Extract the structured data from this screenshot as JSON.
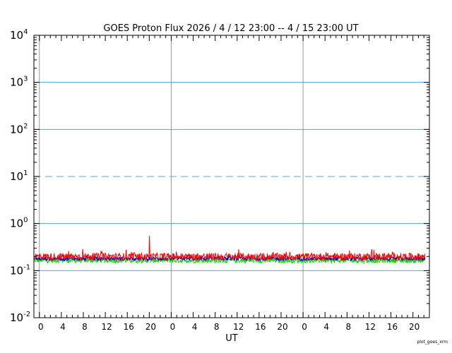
{
  "chart_data": {
    "type": "line",
    "title": "GOES Proton Flux   2026  /  4  / 12   23:00  --   4  / 15   23:00   UT",
    "xlabel": "UT",
    "credit": "plot_goes_xrm",
    "y_scale": "log",
    "ylim": [
      0.01,
      10000
    ],
    "y_ticks": [
      {
        "base": "10",
        "exp": "-2",
        "value": 0.01
      },
      {
        "base": "10",
        "exp": "-1",
        "value": 0.1
      },
      {
        "base": "10",
        "exp": "0",
        "value": 1
      },
      {
        "base": "10",
        "exp": "1",
        "value": 10
      },
      {
        "base": "10",
        "exp": "2",
        "value": 100
      },
      {
        "base": "10",
        "exp": "3",
        "value": 1000
      },
      {
        "base": "10",
        "exp": "4",
        "value": 10000
      }
    ],
    "x_range_hours": [
      0,
      72
    ],
    "x_ticks": [
      {
        "label": "0",
        "hour": 1
      },
      {
        "label": "4",
        "hour": 5
      },
      {
        "label": "8",
        "hour": 9
      },
      {
        "label": "12",
        "hour": 13
      },
      {
        "label": "16",
        "hour": 17
      },
      {
        "label": "20",
        "hour": 21
      },
      {
        "label": "0",
        "hour": 25
      },
      {
        "label": "4",
        "hour": 29
      },
      {
        "label": "8",
        "hour": 33
      },
      {
        "label": "12",
        "hour": 37
      },
      {
        "label": "16",
        "hour": 41
      },
      {
        "label": "20",
        "hour": 45
      },
      {
        "label": "0",
        "hour": 49
      },
      {
        "label": "4",
        "hour": 53
      },
      {
        "label": "8",
        "hour": 57
      },
      {
        "label": "12",
        "hour": 61
      },
      {
        "label": "16",
        "hour": 65
      },
      {
        "label": "20",
        "hour": 69
      }
    ],
    "day_boundaries_hours": [
      1,
      25,
      49
    ],
    "grid_y": [
      0.1,
      1,
      10,
      100,
      1000
    ],
    "dashed_y": [
      10
    ],
    "grid_color": "#4ea1e0",
    "dashed_color": "#8ec9f2",
    "day_line_color": "#999999",
    "series": [
      {
        "color": "#ff0000",
        "baseline": 0.2,
        "noise": 0.18,
        "spikes": [
          [
            21.0,
            0.55
          ],
          [
            8.9,
            0.29
          ],
          [
            16.8,
            0.28
          ]
        ],
        "values_note": ""
      },
      {
        "color": "#0000cc",
        "baseline": 0.18,
        "noise": 0.09,
        "spikes": []
      },
      {
        "color": "#00dd00",
        "baseline": 0.165,
        "noise": 0.12,
        "spikes": []
      }
    ]
  }
}
